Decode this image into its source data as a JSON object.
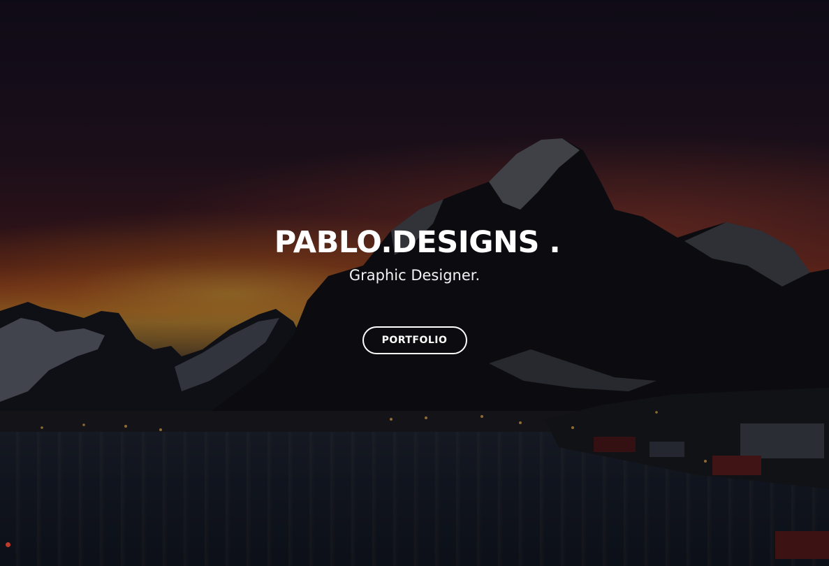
{
  "hero": {
    "brand": "PABLO.DESIGNS .",
    "subtitle": "Graphic Designer.",
    "cta_label": "PORTFOLIO"
  },
  "background": {
    "description_icon": "mountain-lake-sunset-photo",
    "colors": {
      "sky_top": "#1b1426",
      "horizon_glow": "#d98a35",
      "mountain_rock": "#15161d",
      "snow": "#c8ccd6",
      "water": "#1d2434",
      "overlay": "rgba(0,0,0,0.42)"
    }
  }
}
